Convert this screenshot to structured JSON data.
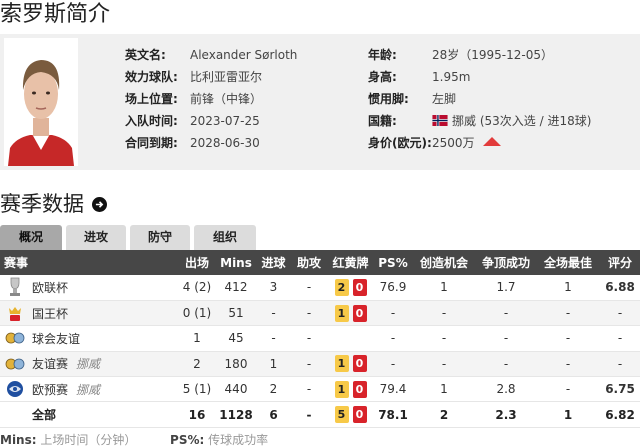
{
  "page_title": "索罗斯简介",
  "profile": {
    "left": [
      {
        "label": "英文名:",
        "value": "Alexander Sørloth"
      },
      {
        "label": "效力球队:",
        "value": "比利亚雷亚尔"
      },
      {
        "label": "场上位置:",
        "value": "前锋（中锋）"
      },
      {
        "label": "入队时间:",
        "value": "2023-07-25"
      },
      {
        "label": "合同到期:",
        "value": "2028-06-30"
      }
    ],
    "right": [
      {
        "label": "年龄:",
        "value": "28岁（1995-12-05）"
      },
      {
        "label": "身高:",
        "value": "1.95m"
      },
      {
        "label": "惯用脚:",
        "value": "左脚"
      },
      {
        "label": "国籍:",
        "value": "挪威 (53次入选 / 进18球)"
      },
      {
        "label": "身价(欧元):",
        "value": "2500万"
      }
    ]
  },
  "section_title": "赛季数据",
  "tabs": [
    "概况",
    "进攻",
    "防守",
    "组织"
  ],
  "table": {
    "headers": [
      "赛事",
      "出场",
      "Mins",
      "进球",
      "助攻",
      "红黄牌",
      "PS%",
      "创造机会",
      "争顶成功",
      "全场最佳",
      "评分"
    ],
    "rows": [
      {
        "comp": "欧联杯",
        "note": "",
        "icon": "europa-league-icon",
        "apps": "4 (2)",
        "mins": "412",
        "goals": "3",
        "assists": "-",
        "yellow": "2",
        "red": "0",
        "ps": "76.9",
        "chances": "1",
        "aerial": "1.7",
        "motm": "1",
        "rating": "6.88"
      },
      {
        "comp": "国王杯",
        "note": "",
        "icon": "copa-del-rey-icon",
        "apps": "0 (1)",
        "mins": "51",
        "goals": "-",
        "assists": "-",
        "yellow": "1",
        "red": "0",
        "ps": "-",
        "chances": "-",
        "aerial": "-",
        "motm": "-",
        "rating": "-"
      },
      {
        "comp": "球会友谊",
        "note": "",
        "icon": "friendly-icon",
        "apps": "1",
        "mins": "45",
        "goals": "-",
        "assists": "-",
        "yellow": "",
        "red": "",
        "ps": "-",
        "chances": "-",
        "aerial": "-",
        "motm": "-",
        "rating": "-"
      },
      {
        "comp": "友谊赛",
        "note": "挪威",
        "icon": "friendly-icon",
        "apps": "2",
        "mins": "180",
        "goals": "1",
        "assists": "-",
        "yellow": "1",
        "red": "0",
        "ps": "-",
        "chances": "-",
        "aerial": "-",
        "motm": "-",
        "rating": "-"
      },
      {
        "comp": "欧预赛",
        "note": "挪威",
        "icon": "euro-qualifiers-icon",
        "apps": "5 (1)",
        "mins": "440",
        "goals": "2",
        "assists": "-",
        "yellow": "1",
        "red": "0",
        "ps": "79.4",
        "chances": "1",
        "aerial": "2.8",
        "motm": "-",
        "rating": "6.75"
      }
    ],
    "total": {
      "comp": "全部",
      "apps": "16",
      "mins": "1128",
      "goals": "6",
      "assists": "-",
      "yellow": "5",
      "red": "0",
      "ps": "78.1",
      "chances": "2",
      "aerial": "2.3",
      "motm": "1",
      "rating": "6.82"
    }
  },
  "footer": {
    "mins_key": "Mins:",
    "mins_desc": "上场时间（分钟）",
    "ps_key": "PS%:",
    "ps_desc": "传球成功率"
  },
  "colors": {
    "header_bg": "#474747",
    "rating": "#e06d1a",
    "red_card": "#d8232a",
    "yellow_card": "#f7c948",
    "market_up": "#e23b3b"
  }
}
